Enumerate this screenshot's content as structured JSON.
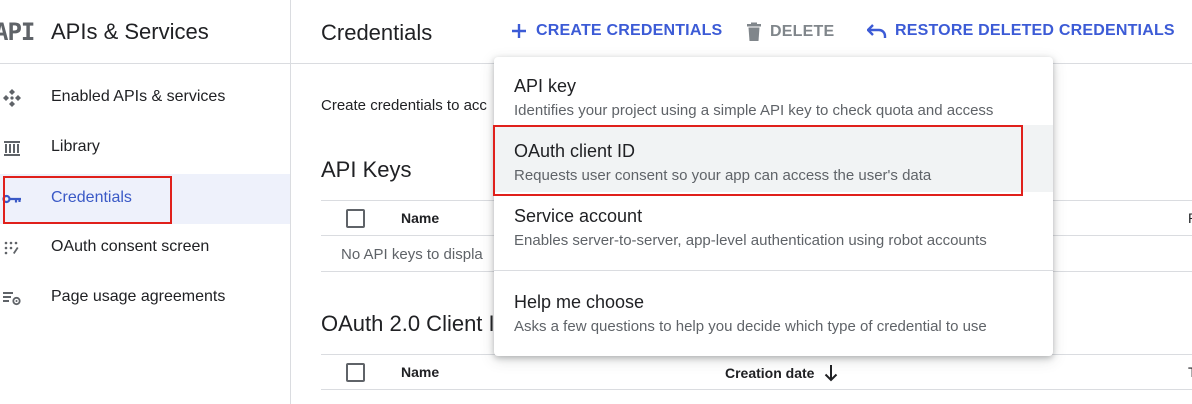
{
  "sidebar": {
    "logo_text": "API",
    "title": "APIs & Services",
    "items": [
      {
        "label": "Enabled APIs & services",
        "icon": "enabled-apis-icon"
      },
      {
        "label": "Library",
        "icon": "library-icon"
      },
      {
        "label": "Credentials",
        "icon": "key-icon"
      },
      {
        "label": "OAuth consent screen",
        "icon": "consent-icon"
      },
      {
        "label": "Page usage agreements",
        "icon": "settings-list-icon"
      }
    ]
  },
  "toolbar": {
    "page_title": "Credentials",
    "create_label": "CREATE CREDENTIALS",
    "delete_label": "DELETE",
    "restore_label": "RESTORE DELETED CREDENTIALS"
  },
  "main": {
    "intro_text": "Create credentials to acc",
    "api_keys_heading": "API Keys",
    "api_keys_table": {
      "col_name": "Name",
      "col_edge": "R",
      "empty_text": "No API keys to displa"
    },
    "oauth_heading": "OAuth 2.0 Client I",
    "oauth_table": {
      "col_name": "Name",
      "col_date": "Creation date",
      "col_edge": "T"
    }
  },
  "menu": {
    "items": [
      {
        "title": "API key",
        "description": "Identifies your project using a simple API key to check quota and access"
      },
      {
        "title": "OAuth client ID",
        "description": "Requests user consent so your app can access the user's data"
      },
      {
        "title": "Service account",
        "description": "Enables server-to-server, app-level authentication using robot accounts"
      },
      {
        "title": "Help me choose",
        "description": "Asks a few questions to help you decide which type of credential to use"
      }
    ]
  },
  "colors": {
    "accent": "#3c5bd6",
    "highlight_box": "#e0201b",
    "active_bg": "#eef1fb"
  }
}
